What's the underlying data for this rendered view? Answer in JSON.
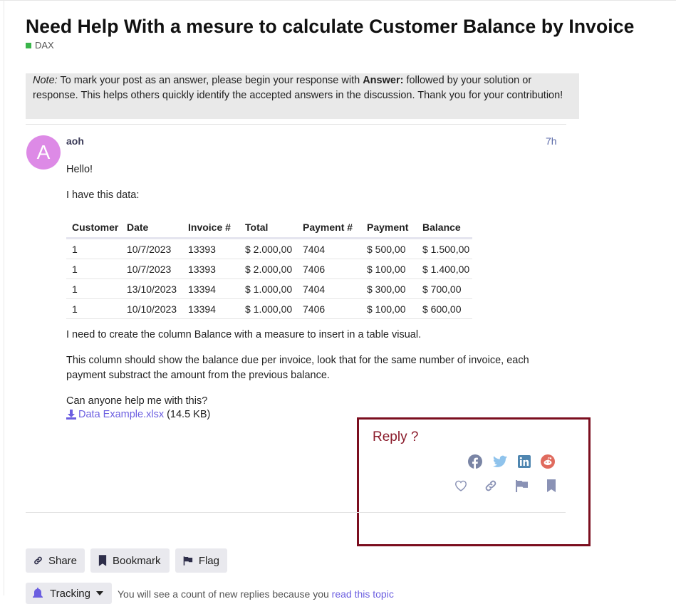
{
  "topic": {
    "title": "Need Help With a mesure to calculate Customer Balance by Invoice",
    "category": "DAX",
    "category_color": "#3ab54a"
  },
  "note": {
    "prefix": "Note:",
    "text1": " To mark your post as an answer, please begin your response with ",
    "bold": "Answer:",
    "text2": " followed by your solution or response. This helps others quickly identify the accepted answers in the discussion. Thank you for your contribution!"
  },
  "post": {
    "avatar_letter": "A",
    "avatar_color": "#dd8ae6",
    "username": "aoh",
    "time": "7h",
    "p1": "Hello!",
    "p2": "I have this data:",
    "table": {
      "headers": [
        "Customer",
        "Date",
        "Invoice #",
        "Total",
        "Payment #",
        "Payment",
        "Balance"
      ],
      "rows": [
        [
          "1",
          "10/7/2023",
          "13393",
          "$ 2.000,00",
          "7404",
          "$ 500,00",
          "$ 1.500,00"
        ],
        [
          "1",
          "10/7/2023",
          "13393",
          "$ 2.000,00",
          "7406",
          "$ 100,00",
          "$ 1.400,00"
        ],
        [
          "1",
          "13/10/2023",
          "13394",
          "$ 1.000,00",
          "7404",
          "$ 300,00",
          "$ 700,00"
        ],
        [
          "1",
          "10/10/2023",
          "13394",
          "$ 1.000,00",
          "7406",
          "$ 100,00",
          "$ 600,00"
        ]
      ]
    },
    "p3": "I need to create the column Balance with a measure to insert in a table visual.",
    "p4": "This column should show the balance due per invoice, look that for the same number of invoice, each payment substract the amount from the previous balance.",
    "p5": "Can anyone help me with this?",
    "attachment_name": "Data Example.xlsx",
    "attachment_size": "(14.5 KB)"
  },
  "reply_annotation": "Reply ?",
  "share_icons": [
    "facebook-icon",
    "twitter-icon",
    "linkedin-icon",
    "reddit-icon"
  ],
  "action_icons": [
    "like-icon",
    "link-icon",
    "flag-icon",
    "bookmark-icon"
  ],
  "buttons": {
    "share": "Share",
    "bookmark": "Bookmark",
    "flag": "Flag",
    "tracking": "Tracking"
  },
  "tracking_text": "You will see a count of new replies because you ",
  "tracking_link": "read this topic"
}
